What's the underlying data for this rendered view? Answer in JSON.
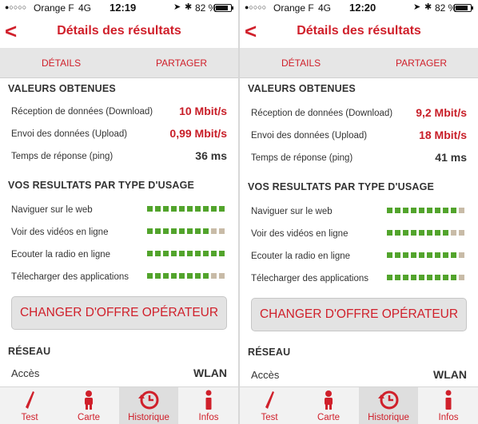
{
  "theme": {
    "accent": "#d0202b",
    "bar_on": "#52a42c",
    "bar_off": "#c8bba7"
  },
  "screens": [
    {
      "status": {
        "signal_dots": "●○○○○",
        "carrier": "Orange F",
        "network": "4G",
        "time": "12:19",
        "battery": "82 %",
        "battery_level": 0.82
      },
      "nav": {
        "back_icon": "chevron-left",
        "title": "Détails des résultats"
      },
      "tabs": {
        "details": "DÉTAILS",
        "share": "PARTAGER"
      },
      "values": {
        "title": "VALEURS OBTENUES",
        "download_label": "Réception de données (Download)",
        "download_value": "10 Mbit/s",
        "upload_label": "Envoi des données (Upload)",
        "upload_value": "0,99 Mbit/s",
        "ping_label": "Temps de réponse (ping)",
        "ping_value": "36 ms"
      },
      "usage": {
        "title": "VOS RESULTATS PAR TYPE D'USAGE",
        "items": [
          {
            "label": "Naviguer sur le web",
            "score": 10,
            "max": 10
          },
          {
            "label": "Voir des vidéos en ligne",
            "score": 8,
            "max": 10
          },
          {
            "label": "Ecouter la radio en ligne",
            "score": 10,
            "max": 10
          },
          {
            "label": "Télecharger des applications",
            "score": 8,
            "max": 10
          }
        ]
      },
      "cta": "CHANGER D'OFFRE OPÉRATEUR",
      "network": {
        "title": "RÉSEAU",
        "access_label": "Accès",
        "access_value": "WLAN"
      },
      "tabbar": [
        {
          "label": "Test",
          "icon": "gauge-needle-icon"
        },
        {
          "label": "Carte",
          "icon": "person-icon"
        },
        {
          "label": "Historique",
          "icon": "history-icon",
          "active": true
        },
        {
          "label": "Infos",
          "icon": "info-icon"
        }
      ]
    },
    {
      "status": {
        "signal_dots": "●○○○○",
        "carrier": "Orange F",
        "network": "4G",
        "time": "12:20",
        "battery": "82 %",
        "battery_level": 0.82
      },
      "nav": {
        "back_icon": "chevron-left",
        "title": "Détails des résultats"
      },
      "tabs": {
        "details": "DÉTAILS",
        "share": "PARTAGER"
      },
      "values": {
        "title": "VALEURS OBTENUES",
        "download_label": "Réception de données (Download)",
        "download_value": "9,2 Mbit/s",
        "upload_label": "Envoi des données (Upload)",
        "upload_value": "18 Mbit/s",
        "ping_label": "Temps de réponse (ping)",
        "ping_value": "41 ms"
      },
      "usage": {
        "title": "VOS RESULTATS PAR TYPE D'USAGE",
        "items": [
          {
            "label": "Naviguer sur le web",
            "score": 9,
            "max": 10
          },
          {
            "label": "Voir des vidéos en ligne",
            "score": 8,
            "max": 10
          },
          {
            "label": "Ecouter la radio en ligne",
            "score": 9,
            "max": 10
          },
          {
            "label": "Télecharger des applications",
            "score": 9,
            "max": 10
          }
        ]
      },
      "cta": "CHANGER D'OFFRE OPÉRATEUR",
      "network": {
        "title": "RÉSEAU",
        "access_label": "Accès",
        "access_value": "WLAN"
      },
      "tabbar": [
        {
          "label": "Test",
          "icon": "gauge-needle-icon"
        },
        {
          "label": "Carte",
          "icon": "person-icon"
        },
        {
          "label": "Historique",
          "icon": "history-icon",
          "active": true
        },
        {
          "label": "Infos",
          "icon": "info-icon"
        }
      ]
    }
  ]
}
